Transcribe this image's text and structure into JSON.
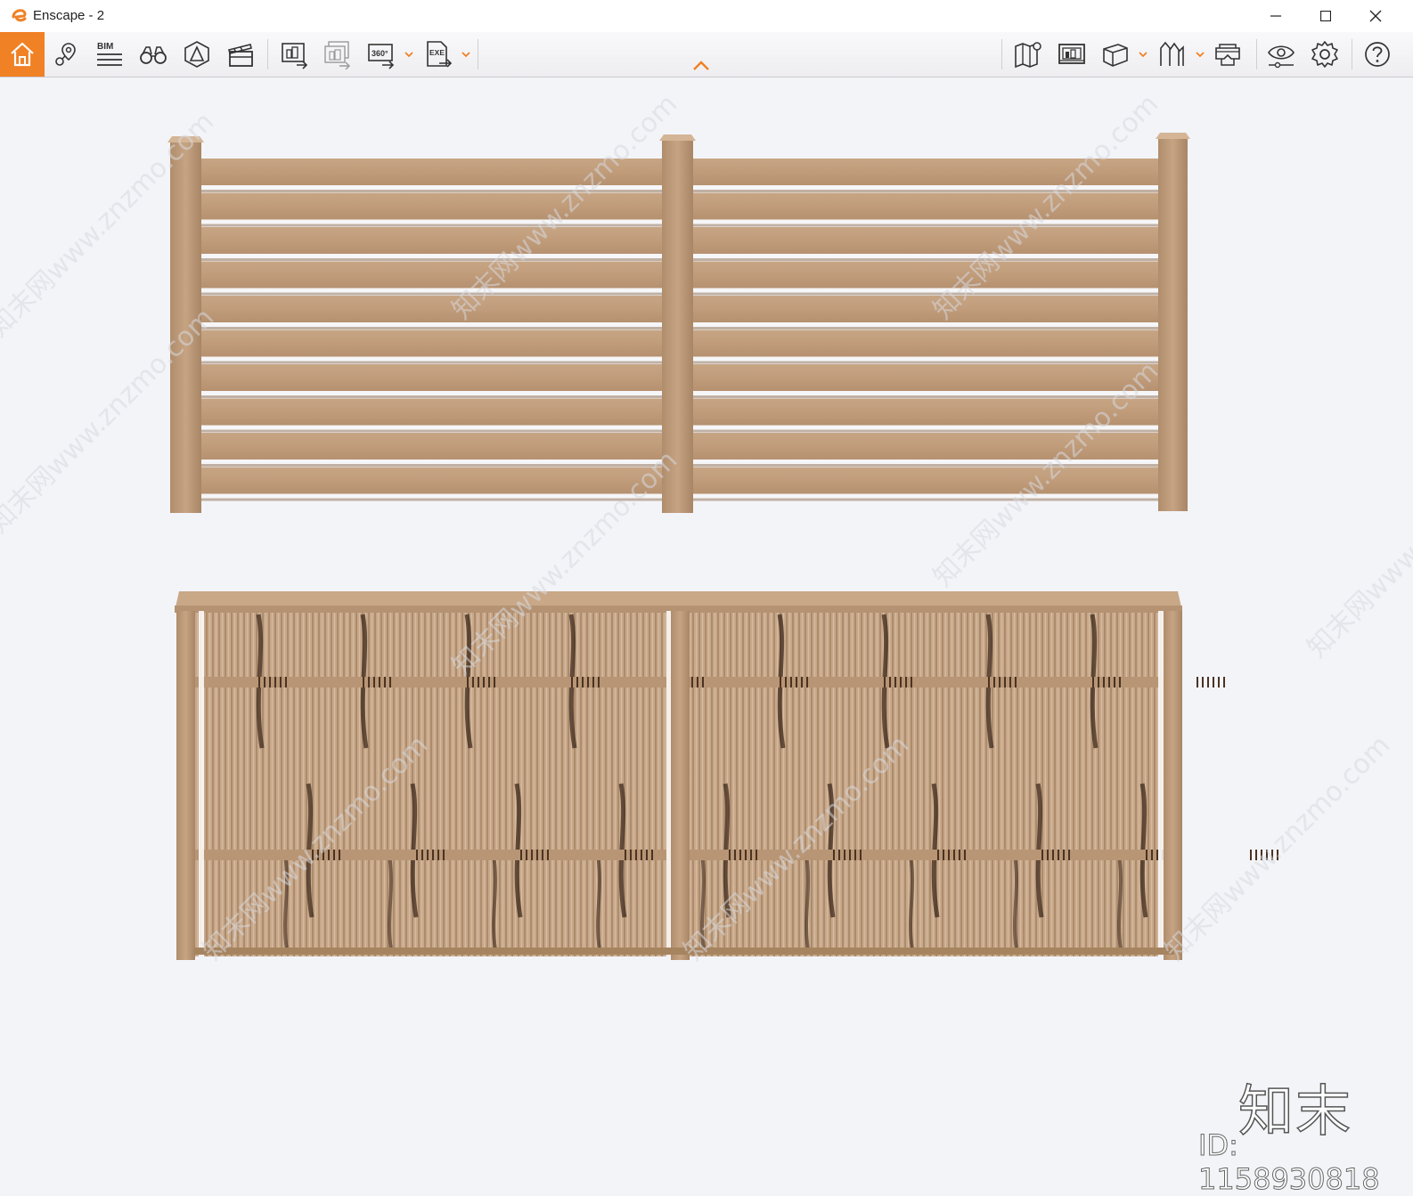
{
  "window": {
    "title": "Enscape - 2"
  },
  "toolbar": {
    "left_tools": [
      "home-icon",
      "location-pin-icon",
      "bim-icon",
      "binoculars-icon",
      "view-management-icon",
      "clapperboard-icon"
    ],
    "export_tools": [
      "render-image-icon",
      "batch-render-icon",
      "panorama-360-icon",
      "export-exe-icon"
    ],
    "right_tools": [
      "map-icon",
      "image-gallery-icon",
      "cube-icon",
      "asset-library-icon",
      "vr-headset-icon",
      "visual-settings-icon",
      "settings-icon",
      "help-icon"
    ],
    "bim_label": "BIM",
    "pano_label": "360°",
    "exe_label": "EXE",
    "accent_color": "#f08124"
  },
  "viewport": {
    "watermark_brand": "知末",
    "watermark_id": "ID: 1158930818",
    "diagonal_watermark": "知末网www.znzmo.com"
  }
}
